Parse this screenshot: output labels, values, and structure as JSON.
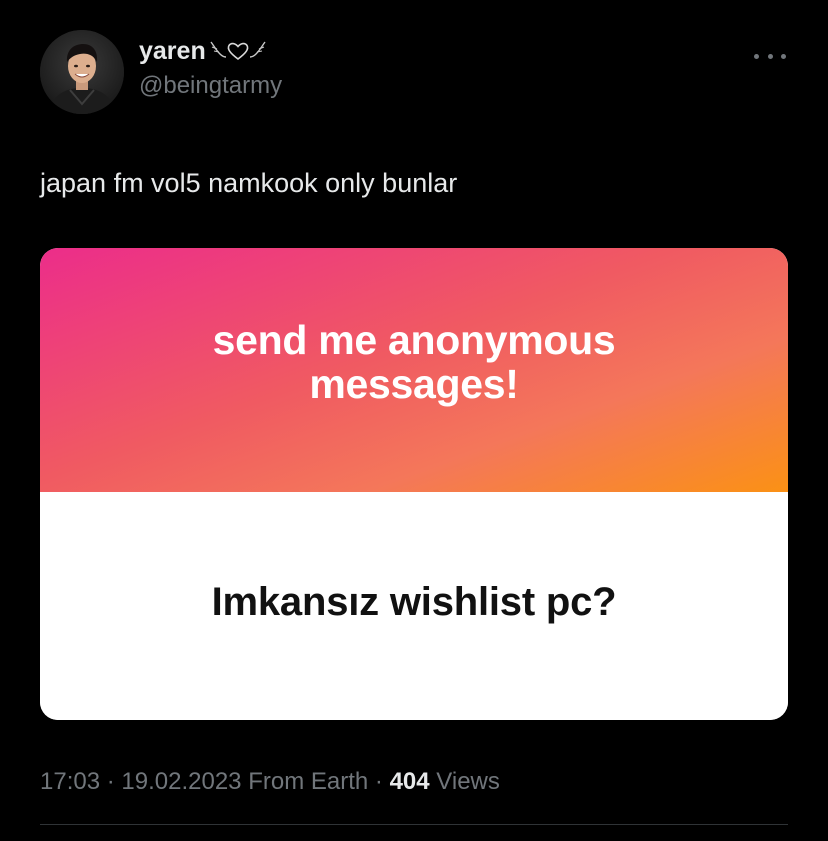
{
  "author": {
    "display_name": "yaren",
    "name_decoration_icon": "wings-heart-icon",
    "handle": "@beingtarmy",
    "avatar_icon": "profile-photo-avatar"
  },
  "more_menu_icon": "more-horizontal-icon",
  "tweet_text": "japan fm vol5 namkook only bunlar",
  "media_card": {
    "title": "send me anonymous messages!",
    "question": "Imkansız wishlist pc?",
    "gradient_colors": [
      "#ec2d8a",
      "#f05a62",
      "#fb9115"
    ]
  },
  "meta": {
    "time": "17:03",
    "separator": "·",
    "date": "19.02.2023",
    "source": "From Earth",
    "views_count": "404",
    "views_label": "Views"
  },
  "colors": {
    "background": "#000000",
    "primary_text": "#e7e9ea",
    "secondary_text": "#71767b",
    "divider": "#2f3336"
  }
}
